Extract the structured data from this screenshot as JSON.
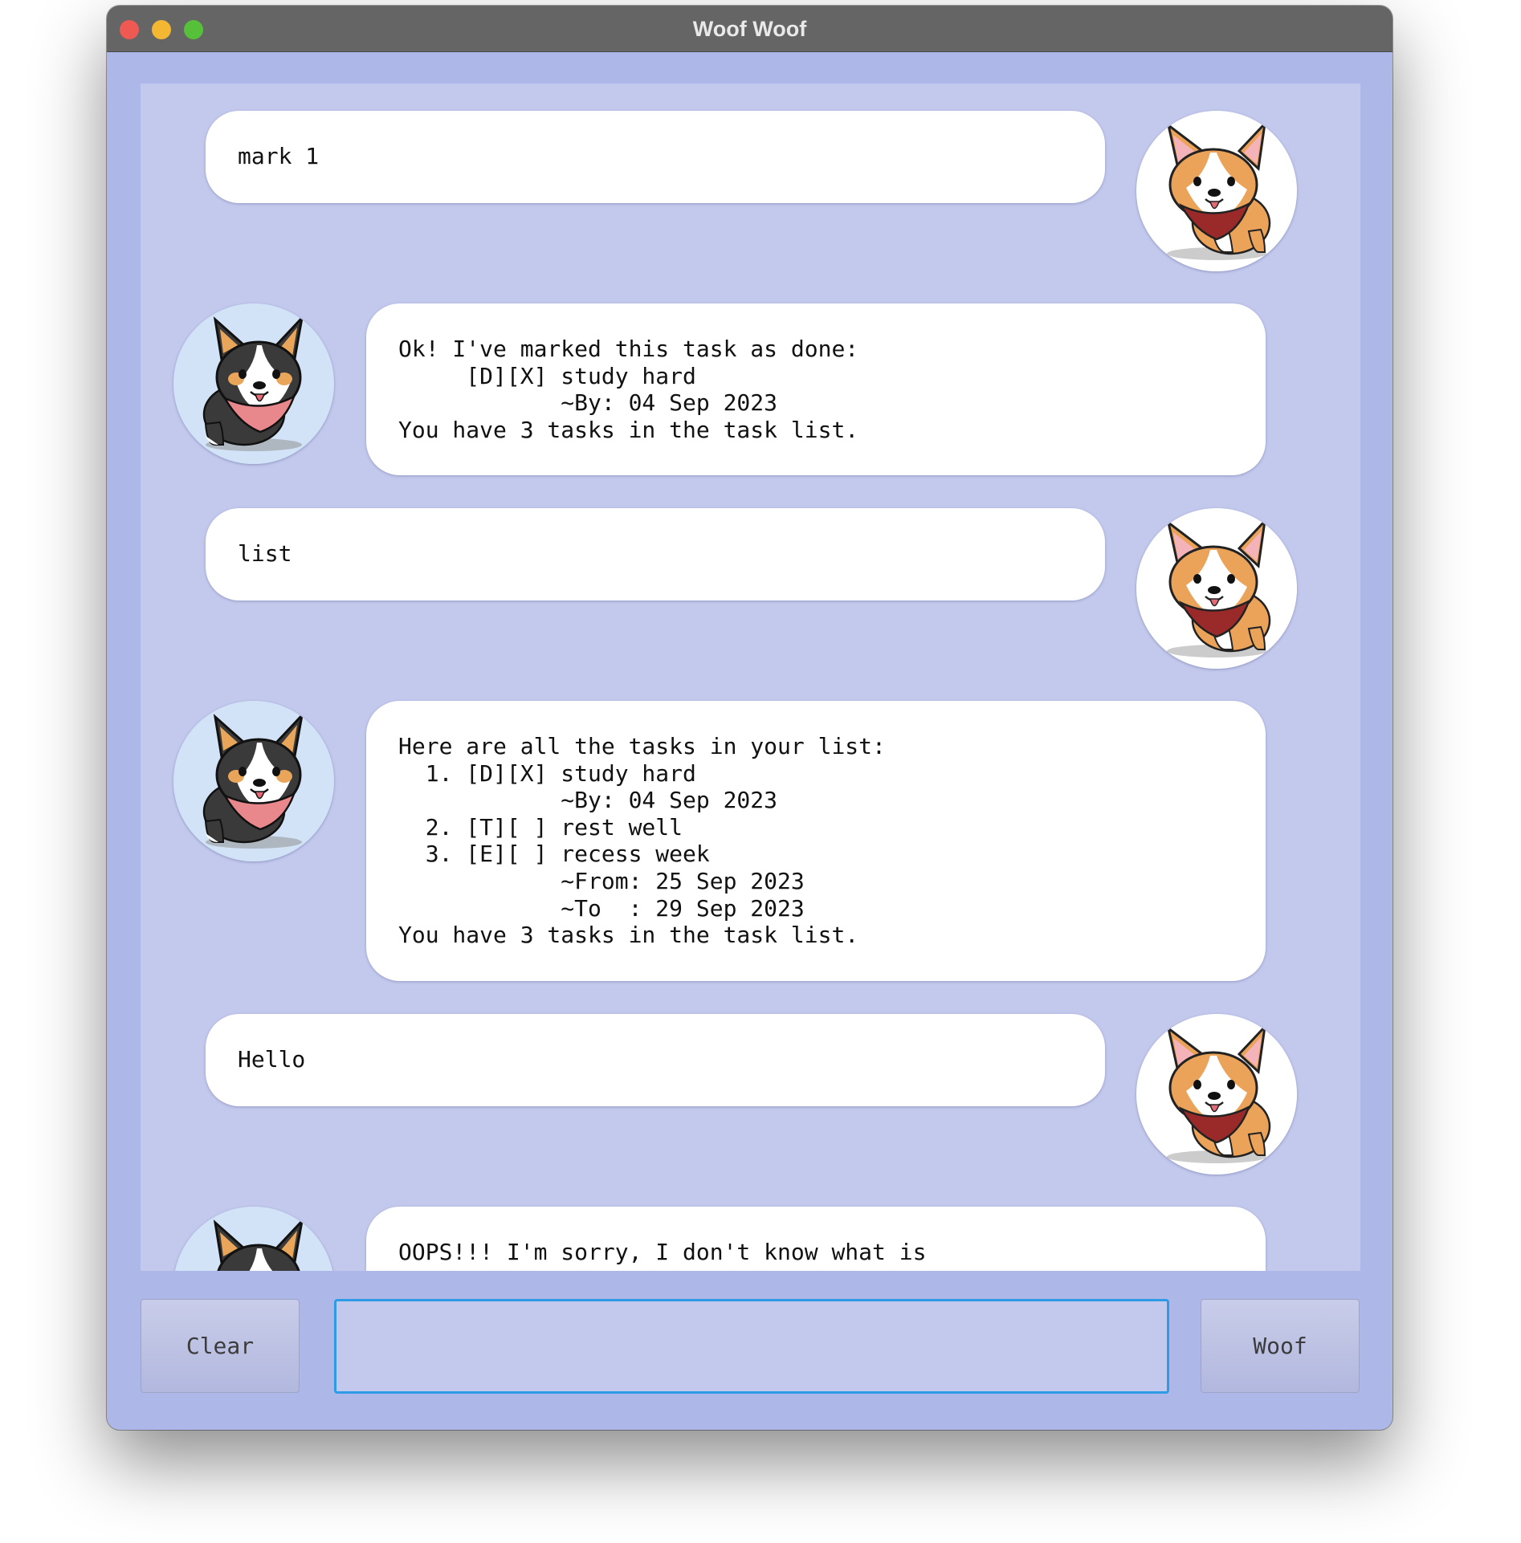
{
  "window": {
    "title": "Woof Woof"
  },
  "dialog": [
    {
      "speaker": "user",
      "avatar": "tan-corgi-avatar",
      "text": "mark 1"
    },
    {
      "speaker": "bot",
      "avatar": "tricolor-corgi-avatar",
      "text": "Ok! I've marked this task as done:\n     [D][X] study hard\n            ~By: 04 Sep 2023\nYou have 3 tasks in the task list."
    },
    {
      "speaker": "user",
      "avatar": "tan-corgi-avatar",
      "text": "list"
    },
    {
      "speaker": "bot",
      "avatar": "tricolor-corgi-avatar",
      "text": "Here are all the tasks in your list:\n  1. [D][X] study hard\n            ~By: 04 Sep 2023\n  2. [T][ ] rest well\n  3. [E][ ] recess week\n            ~From: 25 Sep 2023\n            ~To  : 29 Sep 2023\nYou have 3 tasks in the task list."
    },
    {
      "speaker": "user",
      "avatar": "tan-corgi-avatar",
      "text": "Hello"
    },
    {
      "speaker": "bot",
      "avatar": "tricolor-corgi-avatar",
      "text": "OOPS!!! I'm sorry, I don't know what is\n"
    }
  ],
  "controls": {
    "clear_label": "Clear",
    "send_label": "Woof",
    "input_value": ""
  },
  "colors": {
    "window_bg": "#aeb8e8",
    "scrollpane_bg": "#c3c9ed",
    "bubble_bg": "#ffffff",
    "titlebar": "#656565",
    "input_focus": "#2d9be6"
  }
}
